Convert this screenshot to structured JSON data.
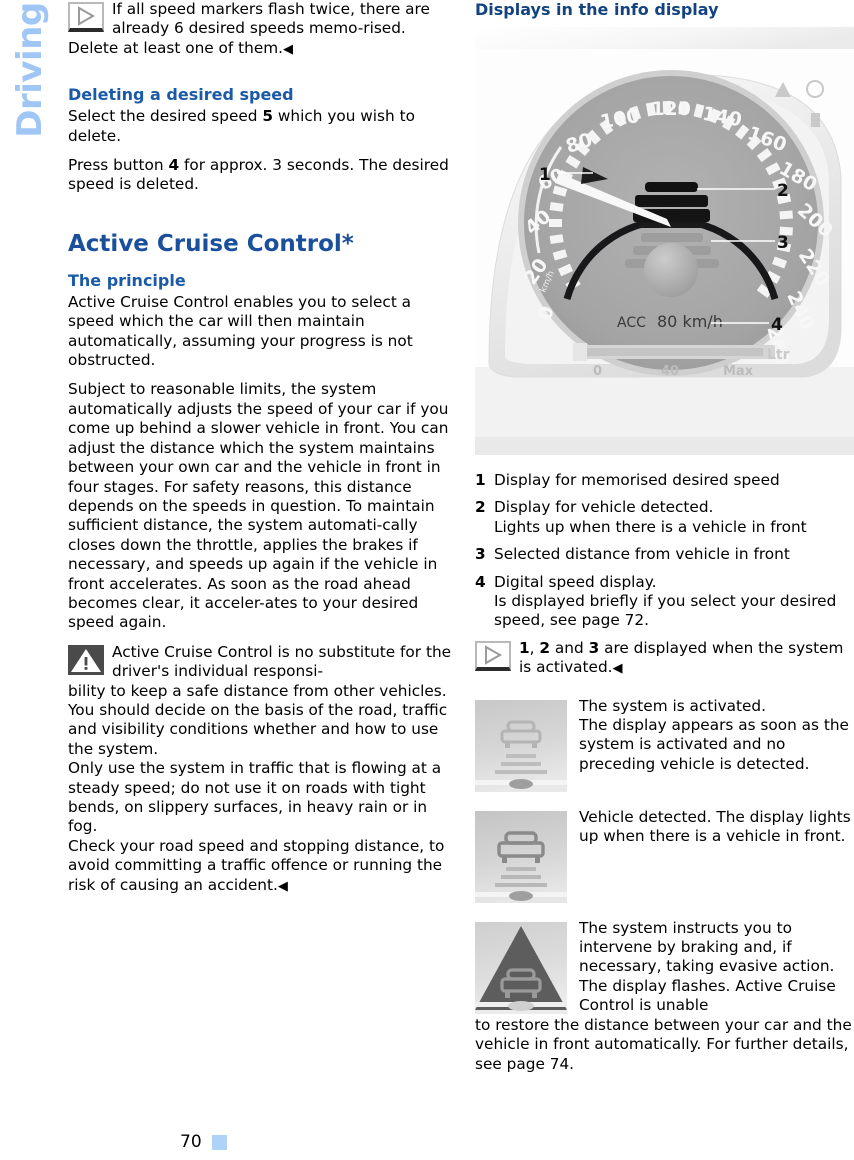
{
  "chapter_tab": {
    "label": "Driving",
    "color": "#9fc6f5"
  },
  "footer": {
    "page_number": "70",
    "marker_color": "#aed3f7"
  },
  "left_column": {
    "intro_note": {
      "icon": "note-play-icon",
      "text": "If all speed markers flash twice, there are already 6 desired speeds memo-rised. Delete at least one of them.",
      "endmark": "◀"
    },
    "deleting_heading": "Deleting a desired speed",
    "deleting_p1_a": "Select the desired speed ",
    "deleting_p1_bold": "5",
    "deleting_p1_b": " which you wish to delete.",
    "deleting_p2_a": "Press button ",
    "deleting_p2_bold": "4",
    "deleting_p2_b": " for approx. 3 seconds. The desired speed is deleted.",
    "acc_heading": "Active Cruise Control*",
    "principle_heading": "The principle",
    "principle_p1": "Active Cruise Control enables you to select a speed which the car will then maintain automatically, assuming your progress is not obstructed.",
    "principle_p2": "Subject to reasonable limits, the system automatically adjusts the speed of your car if you come up behind a slower vehicle in front. You can adjust the distance which the system maintains between your own car and the vehicle in front in four stages. For safety reasons, this distance depends on the speeds in question. To maintain sufficient distance, the system automati-cally closes down the throttle, applies the brakes if necessary, and speeds up again if the vehicle in front accelerates. As soon as the road ahead becomes clear, it acceler-ates to your desired speed again.",
    "warning": {
      "icon": "warning-triangle-icon",
      "indented_text": "Active Cruise Control is no substitute for the driver's individual responsi-",
      "flow_text": "bility to keep a safe distance from other vehicles.\nYou should decide on the basis of the road, traffic and visibility conditions whether and how to use the system.\nOnly use the system in traffic that is flowing at a steady speed; do not use it on roads with tight bends, on slippery surfaces, in heavy rain or in fog.\nCheck your road speed and stopping distance, to avoid committing a traffic offence or running the risk of causing an accident.",
      "endmark": "◀"
    }
  },
  "right_column": {
    "heading": "Displays in the info display",
    "cluster_image": {
      "name": "instrument-cluster-photo",
      "speedometer_ticks": [
        "0",
        "20",
        "40",
        "60",
        "80",
        "100",
        "120",
        "140",
        "160",
        "180",
        "200",
        "220",
        "240",
        "260"
      ],
      "unit_label": "km/h",
      "digital_display": "ACC    80 km/h",
      "fuel_gauge": {
        "left": "0",
        "mid": "40",
        "right": "Max",
        "unit": "Ltr"
      },
      "callouts": [
        "1",
        "2",
        "3",
        "4"
      ]
    },
    "legend": [
      {
        "num": "1",
        "text": "Display for memorised desired speed"
      },
      {
        "num": "2",
        "text": "Display for vehicle detected.\nLights up when there is a vehicle in front"
      },
      {
        "num": "3",
        "text": "Selected distance from vehicle in front"
      },
      {
        "num": "4",
        "text": "Digital speed display.\nIs displayed briefly if you select your desired speed, see page 72."
      }
    ],
    "legend_note": {
      "icon": "note-play-icon",
      "part1_bold": "1",
      "part2": ", ",
      "part3_bold": "2",
      "part4": " and ",
      "part5_bold": "3",
      "part6": " are displayed when the system is activated.",
      "endmark": "◀"
    },
    "states": [
      {
        "thumb": "acc-active-no-vehicle-icon",
        "text": "The system is activated.\nThe display appears as soon as the system is activated and no preceding vehicle is detected."
      },
      {
        "thumb": "acc-vehicle-detected-icon",
        "text": "Vehicle detected. The display lights up when there is a vehicle in front."
      },
      {
        "thumb": "acc-driver-intervene-icon",
        "text_indented": "The system instructs you to intervene by braking and, if necessary, taking evasive action. The display flashes. Active Cruise Control is unable",
        "text_flow": "to restore the distance between your car and the vehicle in front automatically. For further details, see page 74."
      }
    ]
  }
}
